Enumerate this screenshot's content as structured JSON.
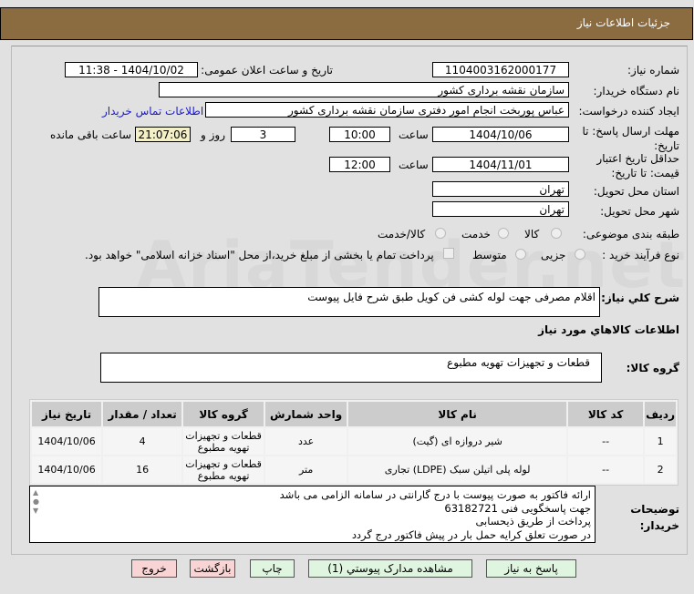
{
  "header": {
    "title": "جزئیات اطلاعات نیاز"
  },
  "watermark": "AriaTender.net",
  "fields": {
    "need_number_label": "شماره نیاز:",
    "need_number": "1104003162000177",
    "announce_label": "تاریخ و ساعت اعلان عمومی:",
    "announce_value": "1404/10/02 - 11:38",
    "buyer_org_label": "نام دستگاه خریدار:",
    "buyer_org": "سازمان نقشه برداری کشور",
    "creator_label": "ایجاد کننده درخواست:",
    "creator": "عباس پوربخت انجام امور دفتری  سازمان نقشه برداری کشور",
    "contact_link": "اطلاعات تماس خریدار",
    "deadline_label": "مهلت ارسال پاسخ: تا تاریخ:",
    "deadline_date": "1404/10/06",
    "time_label": "ساعت",
    "deadline_time": "10:00",
    "days": "3",
    "days_label": "روز و",
    "remaining": "21:07:06",
    "remaining_label": "ساعت باقی مانده",
    "validity_label": "حداقل تاریخ اعتبار قیمت: تا تاریخ:",
    "validity_date": "1404/11/01",
    "validity_time": "12:00",
    "province_label": "استان محل تحویل:",
    "province": "تهران",
    "city_label": "شهر محل تحویل:",
    "city": "تهران",
    "category_label": "طبقه بندی موضوعی:",
    "category_options": [
      "کالا",
      "خدمت",
      "کالا/خدمت"
    ],
    "process_label": "نوع فرآیند خرید :",
    "process_options": [
      "جزیی",
      "متوسط"
    ],
    "payment_note": "پرداخت تمام یا بخشی از مبلغ خرید،از محل \"اسناد خزانه اسلامی\" خواهد بود."
  },
  "description": {
    "label": "شرح کلي نياز:",
    "value": "اقلام مصرفی جهت لوله کشی فن کویل طبق شرح فایل پیوست"
  },
  "goods_info_title": "اطلاعات کالاهاي مورد نياز",
  "goods_group": {
    "label": "گروه کالا:",
    "value": "قطعات و تجهیزات تهویه مطبوع"
  },
  "table": {
    "headers": [
      "ردیف",
      "کد کالا",
      "نام کالا",
      "واحد شمارش",
      "گروه کالا",
      "تعداد / مقدار",
      "تاریخ نیاز"
    ],
    "rows": [
      [
        "1",
        "--",
        "شیر دروازه ای (گیت)",
        "عدد",
        "قطعات و تجهیزات تهویه مطبوع",
        "4",
        "1404/10/06"
      ],
      [
        "2",
        "--",
        "لوله پلی اتیلن سبک (LDPE) تجاری",
        "متر",
        "قطعات و تجهیزات تهویه مطبوع",
        "16",
        "1404/10/06"
      ]
    ]
  },
  "buyer_notes": {
    "label": "توضیحات خریدار:",
    "lines": [
      "ارائه فاکتور به صورت پیوست با درج گارانتی در سامانه الزامی می باشد",
      "جهت پاسخگویی فنی 63182721",
      "پرداخت از طریق ذیحسابی",
      "در صورت تعلق کرایه حمل بار در پیش فاکتور درج گردد"
    ]
  },
  "buttons": {
    "reply": "پاسخ به نیاز",
    "attachments": "مشاهده مدارک پیوستي (1)",
    "print": "چاپ",
    "back": "بازگشت",
    "exit": "خروج"
  }
}
